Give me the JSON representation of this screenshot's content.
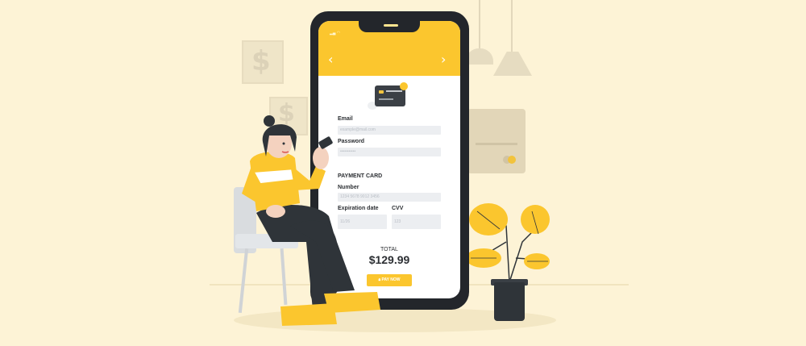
{
  "form": {
    "email_label": "Email",
    "email_value": "example@mail.com",
    "password_label": "Password",
    "password_value": "•••••••••••",
    "section_title": "PAYMENT CARD",
    "number_label": "Number",
    "number_value": "1234 5678 9012 3456",
    "expiration_label": "Expiration date",
    "expiration_value": "11/26",
    "cvv_label": "CVV",
    "cvv_value": "123"
  },
  "total": {
    "label": "TOTAL",
    "amount": "$129.99"
  },
  "pay_button": {
    "label": "PAY NOW"
  },
  "icons": {
    "back": "chevron-left-icon",
    "forward": "chevron-right-icon",
    "card": "credit-card-icon",
    "lock": "lock-icon"
  },
  "colors": {
    "accent": "#fbc62e",
    "background": "#fdf3d6",
    "phone": "#23262b",
    "text": "#2c2f33"
  }
}
